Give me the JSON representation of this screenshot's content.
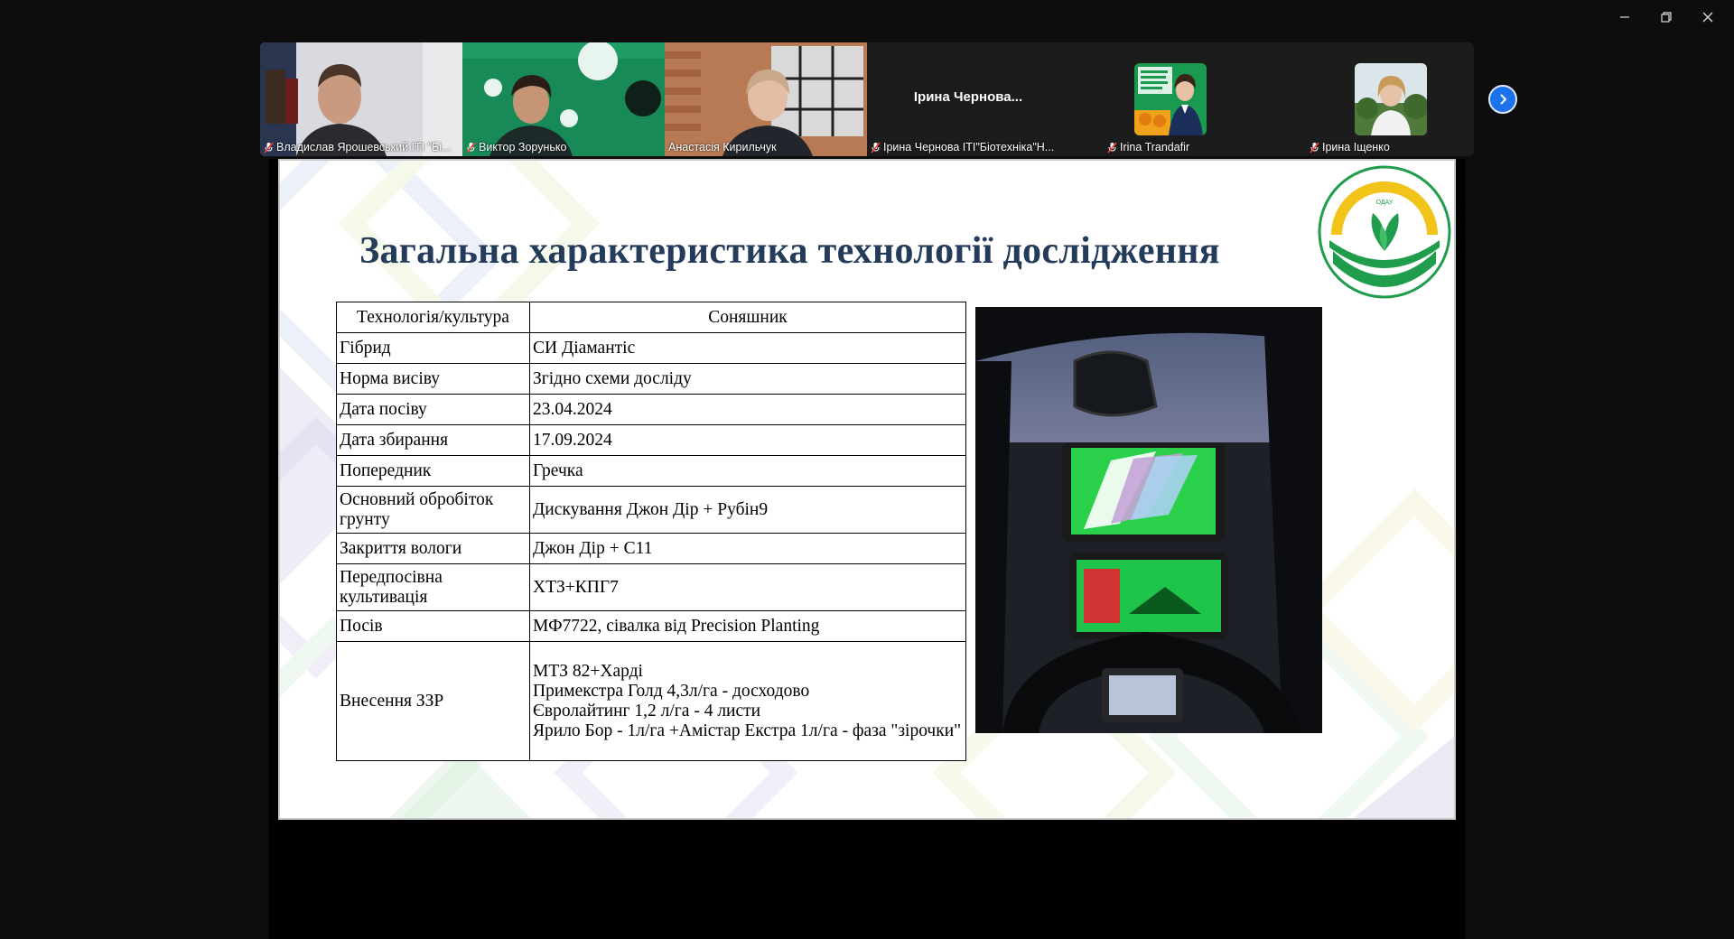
{
  "participants": [
    {
      "name": "Владислав Ярошевський  ІТІ \"Бі...",
      "muted": true
    },
    {
      "name": "Виктор Зорунько",
      "muted": true
    },
    {
      "name": "Анастасія Кирильчук",
      "muted": false,
      "active": true
    },
    {
      "name": "Ірина Чернова ІТІ\"Біотехніка\"Н...",
      "muted": true,
      "display_name": "Ірина  Чернова..."
    },
    {
      "name": "Irina Trandafir",
      "muted": true
    },
    {
      "name": "Ірина Іщенко",
      "muted": true
    }
  ],
  "slide": {
    "title": "Загальна характеристика технології дослідження",
    "table": {
      "header": [
        "Технологія/культура",
        "Соняшник"
      ],
      "rows": [
        [
          "Гібрид",
          "СИ Діамантіс"
        ],
        [
          "Норма висіву",
          "Згідно схеми досліду"
        ],
        [
          "Дата посіву",
          "23.04.2024"
        ],
        [
          "Дата збирання",
          "17.09.2024"
        ],
        [
          "Попередник",
          "Гречка"
        ],
        [
          "Основний обробіток грунту",
          "Дискування Джон Дір + Рубін9"
        ],
        [
          "Закриття вологи",
          "Джон Дір + С11"
        ],
        [
          "Передпосівна культивація",
          "ХТЗ+КПГ7"
        ],
        [
          "Посів",
          "МФ7722, сівалка від Precision Planting"
        ],
        [
          "Внесення ЗЗР",
          "МТЗ 82+Харді\nПримекстра Голд 4,3л/га - досходово\nЄвролайтинг 1,2 л/га - 4 листи\nЯрило Бор - 1л/га +Амістар Екстра 1л/га - фаза \"зірочки\""
        ]
      ]
    },
    "logo_text": "ОДЕСЬКИЙ ДЕРЖАВНИЙ АГРАРНИЙ УНІВЕРСИТЕТ"
  },
  "colors": {
    "accent": "#1a73e8",
    "active_speaker": "#2fd17a",
    "title": "#243b5a",
    "logo_green": "#1f9d4c",
    "logo_yellow": "#f2c318"
  }
}
